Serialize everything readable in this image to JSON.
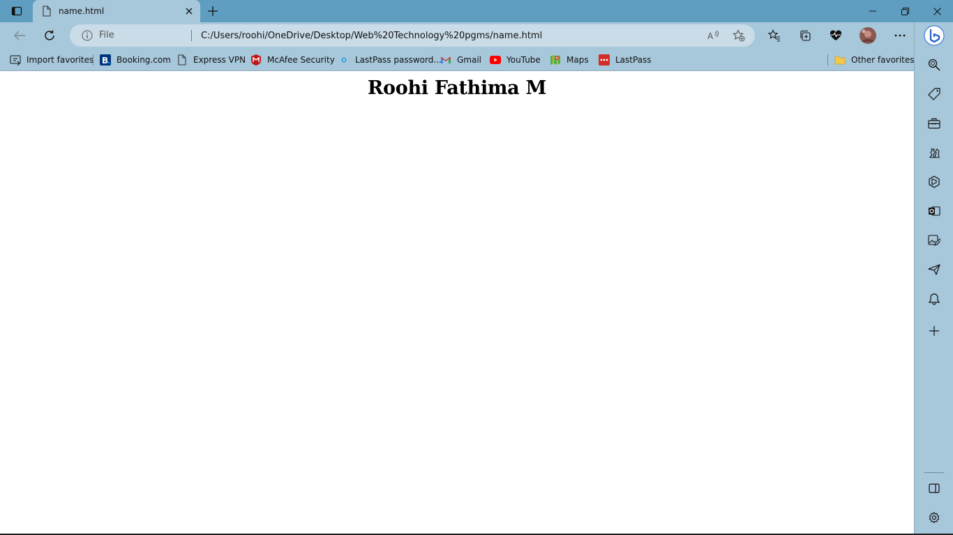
{
  "tab": {
    "title": "name.html",
    "icon": "document-icon"
  },
  "address": {
    "prefix": "File",
    "url": "C:/Users/roohi/OneDrive/Desktop/Web%20Technology%20pgms/name.html"
  },
  "favorites": [
    {
      "label": "Import favorites",
      "icon": "import-icon"
    },
    {
      "label": "Booking.com",
      "icon": "booking-icon"
    },
    {
      "label": "Express VPN",
      "icon": "document-icon"
    },
    {
      "label": "McAfee Security",
      "icon": "mcafee-icon"
    },
    {
      "label": "LastPass password...",
      "icon": "lastpass-dot-icon"
    },
    {
      "label": "Gmail",
      "icon": "gmail-icon"
    },
    {
      "label": "YouTube",
      "icon": "youtube-icon"
    },
    {
      "label": "Maps",
      "icon": "maps-icon"
    },
    {
      "label": "LastPass",
      "icon": "lastpass-icon"
    }
  ],
  "other_favorites": {
    "label": "Other favorites",
    "icon": "folder-icon"
  },
  "page": {
    "heading": "Roohi Fathima M"
  },
  "colors": {
    "frame": "#5f9ec0",
    "toolbar": "#a7c7db",
    "address_bar": "#c9dce8",
    "content_bg": "#ffffff"
  }
}
